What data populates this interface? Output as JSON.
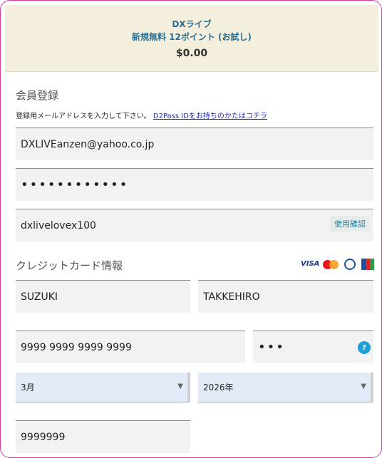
{
  "header": {
    "product": "DXライブ",
    "plan": "新規無料 12ポイント (お試し)",
    "price": "$0.00"
  },
  "membership": {
    "title": "会員登録",
    "note": "登録用メールアドレスを入力して下さい。",
    "note_link": "D2Pass IDをお持ちのかたはコチラ",
    "email_value": "DXLIVEanzen@yahoo.co.jp",
    "password_mask": "••••••••••••",
    "username_value": "dxlivelovex100",
    "check_button": "使用確認"
  },
  "credit_card": {
    "title": "クレジットカード情報",
    "card_icons": [
      "visa-icon",
      "mastercard-icon",
      "diners-club-icon",
      "jcb-icon"
    ],
    "visa_label": "VISA",
    "last_name": "SUZUKI",
    "first_name": "TAKKEHIRO",
    "card_number": "9999 9999 9999 9999",
    "cvv_mask": "•••",
    "help_label": "?",
    "month": "3月",
    "year": "2026年",
    "postal_code": "9999999"
  },
  "colors": {
    "frame_border": "#d63ba7",
    "header_bg": "#f4efdc",
    "header_text": "#2a6f91",
    "help_icon": "#1ea0d6",
    "link": "#1e2bbd"
  }
}
